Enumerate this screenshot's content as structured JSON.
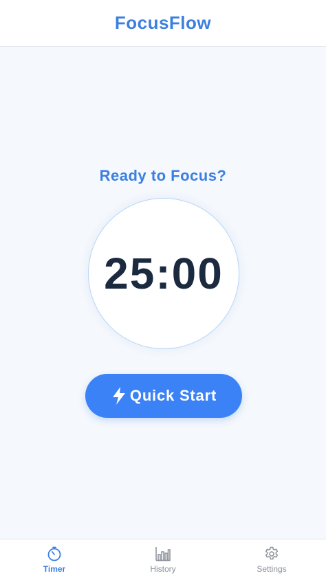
{
  "header": {
    "title": "FocusFlow"
  },
  "main": {
    "prompt": "Ready to Focus?",
    "timer": "25:00",
    "quick_start_label": "Quick Start",
    "quick_start_icon": "lightning-bolt-icon"
  },
  "nav": {
    "items": [
      {
        "label": "Timer",
        "icon": "stopwatch-icon",
        "active": true
      },
      {
        "label": "History",
        "icon": "bar-chart-icon",
        "active": false
      },
      {
        "label": "Settings",
        "icon": "gear-icon",
        "active": false
      }
    ]
  },
  "colors": {
    "accent": "#3b7fe0",
    "button": "#3b82f6",
    "background": "#f5f8fc",
    "timer_text": "#1c2a40",
    "inactive": "#8a8f98"
  }
}
